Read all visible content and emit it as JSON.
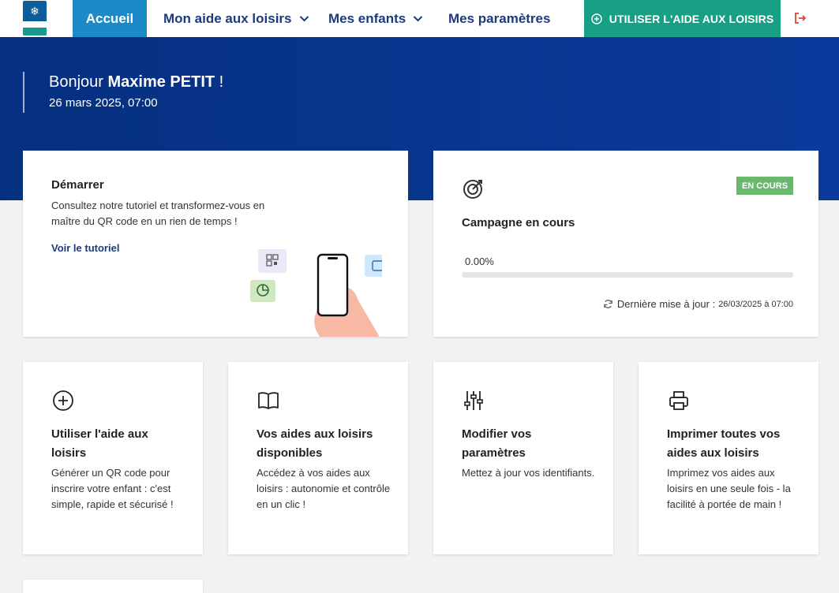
{
  "nav": {
    "logo_icon": "caf-logo",
    "items": [
      {
        "label": "Accueil",
        "active": true
      },
      {
        "label": "Mon aide aux loisirs",
        "has_dropdown": true
      },
      {
        "label": "Mes enfants",
        "has_dropdown": true
      },
      {
        "label": "Mes paramètres",
        "has_dropdown": false
      }
    ],
    "cta_label": "UTILISER L'AIDE AUX LOISIRS",
    "cta_icon": "plus-circle-icon",
    "logout_icon": "logout-icon"
  },
  "hero": {
    "greeting_prefix": "Bonjour ",
    "user_name": "Maxime PETIT",
    "greeting_suffix": " !",
    "date": "26 mars 2025, 07:00"
  },
  "start_card": {
    "title": "Démarrer",
    "description": "Consultez notre tutoriel et transformez-vous en maître du QR code en un rien de temps !",
    "link": "Voir le tutoriel"
  },
  "campaign_card": {
    "icon": "target-icon",
    "badge": "EN COURS",
    "title": "Campagne en cours",
    "progress_label": "0.00%",
    "progress_fraction": 0.0,
    "updated_label": "Dernière mise à jour :",
    "updated_ts": "26/03/2025 à 07:00"
  },
  "tiles": [
    {
      "icon": "plus-circle-icon",
      "title": "Utiliser l'aide aux loisirs",
      "text": "Générer un QR code pour inscrire votre enfant : c'est simple, rapide et sécurisé !"
    },
    {
      "icon": "book-icon",
      "title": "Vos aides aux loisirs disponibles",
      "text": "Accédez à vos aides aux loisirs : autonomie et contrôle en un clic !"
    },
    {
      "icon": "sliders-icon",
      "title": "Modifier vos paramètres",
      "text": "Mettez à jour vos identifiants."
    },
    {
      "icon": "printer-icon",
      "title": "Imprimer toutes vos aides aux loisirs",
      "text": "Imprimez vos aides aux loisirs en une seule fois - la facilité à portée de main !"
    }
  ],
  "colors": {
    "primary": "#1d3b7a",
    "active_tab": "#1d8ac8",
    "cta": "#17a084",
    "hero": "#06307f",
    "badge": "#6ab86e",
    "logout": "#e0413a"
  }
}
